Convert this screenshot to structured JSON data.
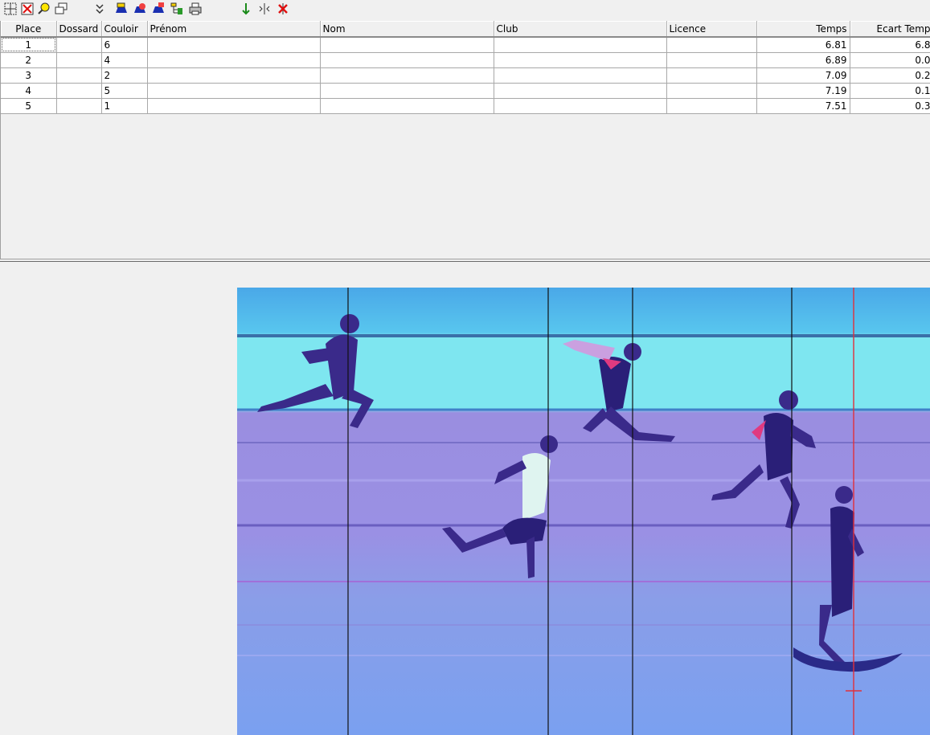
{
  "toolbar": {
    "buttons": [
      {
        "icon": "capture-icon"
      },
      {
        "icon": "delete-capture-icon"
      },
      {
        "icon": "zoom-icon"
      },
      {
        "icon": "windows-icon"
      },
      {
        "icon": "expand-icon"
      },
      {
        "icon": "edit-runner-icon"
      },
      {
        "icon": "runner-clear-icon"
      },
      {
        "icon": "runner-add-icon"
      },
      {
        "icon": "tree-icon"
      },
      {
        "icon": "print-icon"
      },
      {
        "icon": "add-time-icon"
      },
      {
        "icon": "split-icon"
      },
      {
        "icon": "remove-time-icon"
      }
    ]
  },
  "results": {
    "columns": [
      "Place",
      "Dossard",
      "Couloir",
      "Prénom",
      "Nom",
      "Club",
      "Licence",
      "Temps",
      "Ecart Temp"
    ],
    "rows": [
      {
        "place": "1",
        "dossard": "",
        "couloir": "6",
        "prenom": "",
        "nom": "",
        "club": "",
        "licence": "",
        "temps": "6.81",
        "ecart": "6.8"
      },
      {
        "place": "2",
        "dossard": "",
        "couloir": "4",
        "prenom": "",
        "nom": "",
        "club": "",
        "licence": "",
        "temps": "6.89",
        "ecart": "0.0"
      },
      {
        "place": "3",
        "dossard": "",
        "couloir": "2",
        "prenom": "",
        "nom": "",
        "club": "",
        "licence": "",
        "temps": "7.09",
        "ecart": "0.2"
      },
      {
        "place": "4",
        "dossard": "",
        "couloir": "5",
        "prenom": "",
        "nom": "",
        "club": "",
        "licence": "",
        "temps": "7.19",
        "ecart": "0.1"
      },
      {
        "place": "5",
        "dossard": "",
        "couloir": "1",
        "prenom": "",
        "nom": "",
        "club": "",
        "licence": "",
        "temps": "7.51",
        "ecart": "0.3"
      }
    ]
  },
  "photo_finish": {
    "time_markers": 5,
    "finish_line_color": "#e0303a"
  },
  "colors": {
    "track_sky": "#7ee6f0",
    "track_purple": "#9a8ee0",
    "track_blue": "#7aa0f0"
  }
}
